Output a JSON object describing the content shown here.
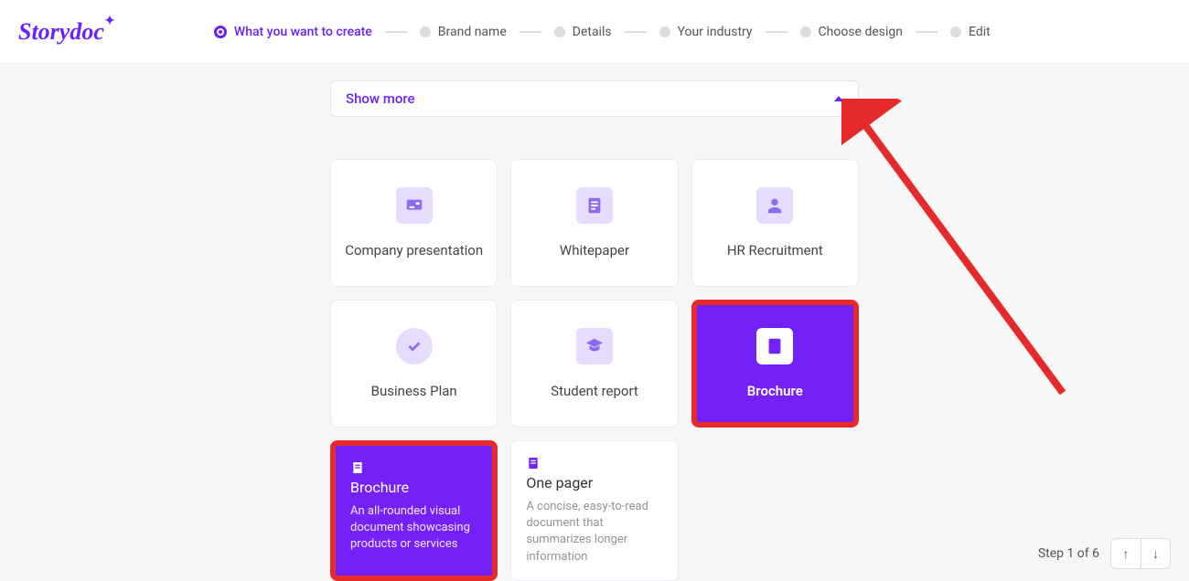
{
  "brand": "Storydoc",
  "steps": [
    {
      "label": "What you want to create",
      "active": true
    },
    {
      "label": "Brand name",
      "active": false
    },
    {
      "label": "Details",
      "active": false
    },
    {
      "label": "Your industry",
      "active": false
    },
    {
      "label": "Choose design",
      "active": false
    },
    {
      "label": "Edit",
      "active": false
    }
  ],
  "showmore": {
    "label": "Show more"
  },
  "cards": {
    "c0": {
      "label": "Company presentation",
      "icon": "presentation-icon"
    },
    "c1": {
      "label": "Whitepaper",
      "icon": "document-icon"
    },
    "c2": {
      "label": "HR Recruitment",
      "icon": "person-icon"
    },
    "c3": {
      "label": "Business Plan",
      "icon": "checkmark-icon"
    },
    "c4": {
      "label": "Student report",
      "icon": "graduation-cap-icon"
    },
    "c5": {
      "label": "Brochure",
      "icon": "document-icon",
      "selected": true
    }
  },
  "detail": {
    "sel": {
      "title": "Brochure",
      "desc": "An all-rounded visual document showcasing products or services"
    },
    "other": {
      "title": "One pager",
      "desc": "A concise, easy-to-read document that summarizes longer information"
    }
  },
  "footer": {
    "step_text": "Step 1 of 6"
  },
  "colors": {
    "accent": "#7421f7",
    "highlight": "#e42a2a"
  }
}
